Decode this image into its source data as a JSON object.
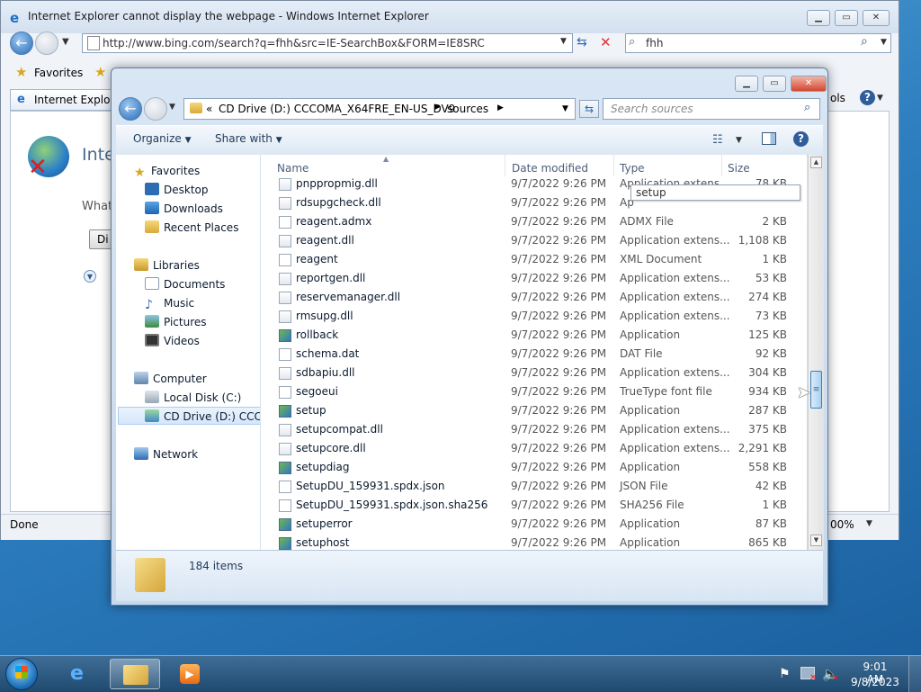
{
  "ie": {
    "title": "Internet Explorer cannot display the webpage - Windows Internet Explorer",
    "address": "http://www.bing.com/search?q=fhh&src=IE-SearchBox&FORM=IE8SRC",
    "search_value": "fhh",
    "favorites_label": "Favorites",
    "tab_label": "Internet Explorer",
    "tools_fragment": "ols",
    "page_heading_fragment": "Inte",
    "page_text_fragment": "What",
    "page_button_fragment": "Di",
    "status_text": "Done",
    "zoom_fragment": "00%"
  },
  "explorer": {
    "breadcrumb": {
      "prefix": "«",
      "drive": "CD Drive (D:) CCCOMA_X64FRE_EN-US_DV9",
      "folder": "sources"
    },
    "search_placeholder": "Search sources",
    "toolbar": {
      "organize": "Organize",
      "share_with": "Share with"
    },
    "nav": {
      "favorites": "Favorites",
      "desktop": "Desktop",
      "downloads": "Downloads",
      "recent_places": "Recent Places",
      "libraries": "Libraries",
      "documents": "Documents",
      "music": "Music",
      "pictures": "Pictures",
      "videos": "Videos",
      "computer": "Computer",
      "local_disk": "Local Disk (C:)",
      "cd_drive": "CD Drive (D:) CCCOI",
      "network": "Network"
    },
    "columns": {
      "name": "Name",
      "date": "Date modified",
      "type": "Type",
      "size": "Size"
    },
    "files": [
      {
        "name": "pnppropmig.dll",
        "date": "9/7/2022 9:26 PM",
        "type": "Application extens...",
        "size": "78 KB",
        "icon": "dll"
      },
      {
        "name": "rdsupgcheck.dll",
        "date": "9/7/2022 9:26 PM",
        "type": "Ap",
        "size": "",
        "icon": "dll"
      },
      {
        "name": "reagent.admx",
        "date": "9/7/2022 9:26 PM",
        "type": "ADMX File",
        "size": "2 KB",
        "icon": "file"
      },
      {
        "name": "reagent.dll",
        "date": "9/7/2022 9:26 PM",
        "type": "Application extens...",
        "size": "1,108 KB",
        "icon": "dll"
      },
      {
        "name": "reagent",
        "date": "9/7/2022 9:26 PM",
        "type": "XML Document",
        "size": "1 KB",
        "icon": "file"
      },
      {
        "name": "reportgen.dll",
        "date": "9/7/2022 9:26 PM",
        "type": "Application extens...",
        "size": "53 KB",
        "icon": "dll"
      },
      {
        "name": "reservemanager.dll",
        "date": "9/7/2022 9:26 PM",
        "type": "Application extens...",
        "size": "274 KB",
        "icon": "dll"
      },
      {
        "name": "rmsupg.dll",
        "date": "9/7/2022 9:26 PM",
        "type": "Application extens...",
        "size": "73 KB",
        "icon": "dll"
      },
      {
        "name": "rollback",
        "date": "9/7/2022 9:26 PM",
        "type": "Application",
        "size": "125 KB",
        "icon": "app"
      },
      {
        "name": "schema.dat",
        "date": "9/7/2022 9:26 PM",
        "type": "DAT File",
        "size": "92 KB",
        "icon": "file"
      },
      {
        "name": "sdbapiu.dll",
        "date": "9/7/2022 9:26 PM",
        "type": "Application extens...",
        "size": "304 KB",
        "icon": "dll"
      },
      {
        "name": "segoeui",
        "date": "9/7/2022 9:26 PM",
        "type": "TrueType font file",
        "size": "934 KB",
        "icon": "file"
      },
      {
        "name": "setup",
        "date": "9/7/2022 9:26 PM",
        "type": "Application",
        "size": "287 KB",
        "icon": "app"
      },
      {
        "name": "setupcompat.dll",
        "date": "9/7/2022 9:26 PM",
        "type": "Application extens...",
        "size": "375 KB",
        "icon": "dll"
      },
      {
        "name": "setupcore.dll",
        "date": "9/7/2022 9:26 PM",
        "type": "Application extens...",
        "size": "2,291 KB",
        "icon": "dll"
      },
      {
        "name": "setupdiag",
        "date": "9/7/2022 9:26 PM",
        "type": "Application",
        "size": "558 KB",
        "icon": "app"
      },
      {
        "name": "SetupDU_159931.spdx.json",
        "date": "9/7/2022 9:26 PM",
        "type": "JSON File",
        "size": "42 KB",
        "icon": "file"
      },
      {
        "name": "SetupDU_159931.spdx.json.sha256",
        "date": "9/7/2022 9:26 PM",
        "type": "SHA256 File",
        "size": "1 KB",
        "icon": "file"
      },
      {
        "name": "setuperror",
        "date": "9/7/2022 9:26 PM",
        "type": "Application",
        "size": "87 KB",
        "icon": "app"
      },
      {
        "name": "setuphost",
        "date": "9/7/2022 9:26 PM",
        "type": "Application",
        "size": "865 KB",
        "icon": "app"
      }
    ],
    "tooltip": "setup",
    "item_count": "184 items"
  },
  "taskbar": {
    "time": "9:01 AM",
    "date": "9/8/2023"
  }
}
